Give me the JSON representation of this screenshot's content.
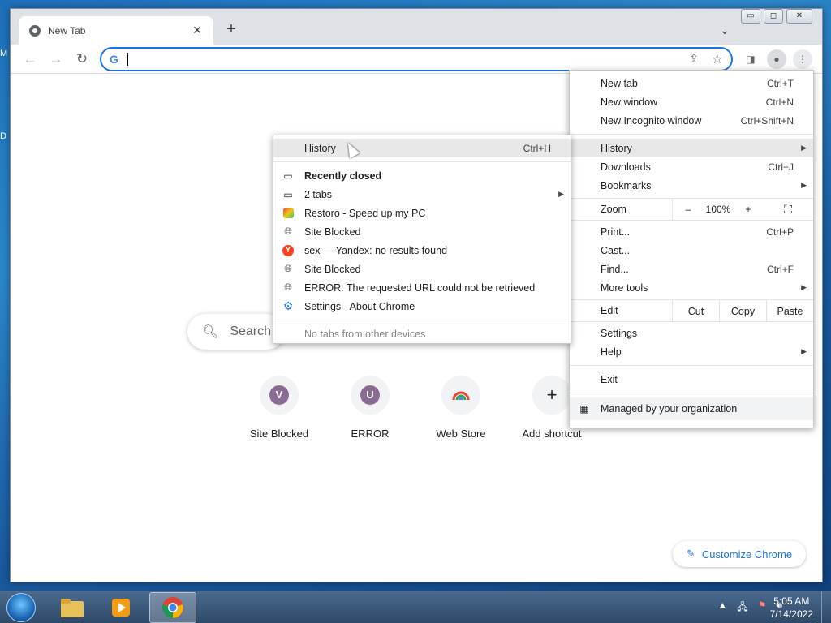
{
  "desktop": {
    "edge_letters": [
      "M",
      "D"
    ]
  },
  "window": {
    "tab_title": "New Tab",
    "window_controls": {
      "minimize": "▭",
      "maximize": "◻",
      "close": "✕"
    }
  },
  "omnibox": {
    "value": "",
    "g_label": "G"
  },
  "ntp": {
    "search_placeholder": "Search",
    "shortcuts": [
      {
        "letter": "V",
        "label": "Site Blocked"
      },
      {
        "letter": "U",
        "label": "ERROR"
      },
      {
        "letter": "",
        "label": "Web Store"
      },
      {
        "letter": "+",
        "label": "Add shortcut"
      }
    ],
    "customize_label": "Customize Chrome"
  },
  "main_menu": {
    "new_tab": {
      "label": "New tab",
      "accel": "Ctrl+T"
    },
    "new_window": {
      "label": "New window",
      "accel": "Ctrl+N"
    },
    "new_incognito": {
      "label": "New Incognito window",
      "accel": "Ctrl+Shift+N"
    },
    "history": {
      "label": "History"
    },
    "downloads": {
      "label": "Downloads",
      "accel": "Ctrl+J"
    },
    "bookmarks": {
      "label": "Bookmarks"
    },
    "zoom": {
      "label": "Zoom",
      "minus": "–",
      "value": "100%",
      "plus": "+"
    },
    "print": {
      "label": "Print...",
      "accel": "Ctrl+P"
    },
    "cast": {
      "label": "Cast..."
    },
    "find": {
      "label": "Find...",
      "accel": "Ctrl+F"
    },
    "more_tools": {
      "label": "More tools"
    },
    "edit": {
      "label": "Edit",
      "cut": "Cut",
      "copy": "Copy",
      "paste": "Paste"
    },
    "settings": {
      "label": "Settings"
    },
    "help": {
      "label": "Help"
    },
    "exit": {
      "label": "Exit"
    },
    "managed": {
      "label": "Managed by your organization"
    }
  },
  "history_menu": {
    "history": {
      "label": "History",
      "accel": "Ctrl+H"
    },
    "recently_closed": "Recently closed",
    "items": [
      {
        "icon": "window-icon",
        "label": "2 tabs",
        "submenu": true
      },
      {
        "icon": "restoro-icon",
        "label": "Restoro - Speed up my PC"
      },
      {
        "icon": "globe-icon",
        "label": "Site Blocked"
      },
      {
        "icon": "yandex-icon",
        "label": "sex — Yandex: no results found"
      },
      {
        "icon": "globe-icon",
        "label": "Site Blocked"
      },
      {
        "icon": "globe-icon",
        "label": "ERROR: The requested URL could not be retrieved"
      },
      {
        "icon": "gear-icon",
        "label": "Settings - About Chrome"
      }
    ],
    "no_tabs": "No tabs from other devices"
  },
  "taskbar": {
    "time": "5:05 AM",
    "date": "7/14/2022"
  },
  "colors": {
    "accent": "#1a73e8",
    "menu_highlight": "#e8e8e8"
  }
}
